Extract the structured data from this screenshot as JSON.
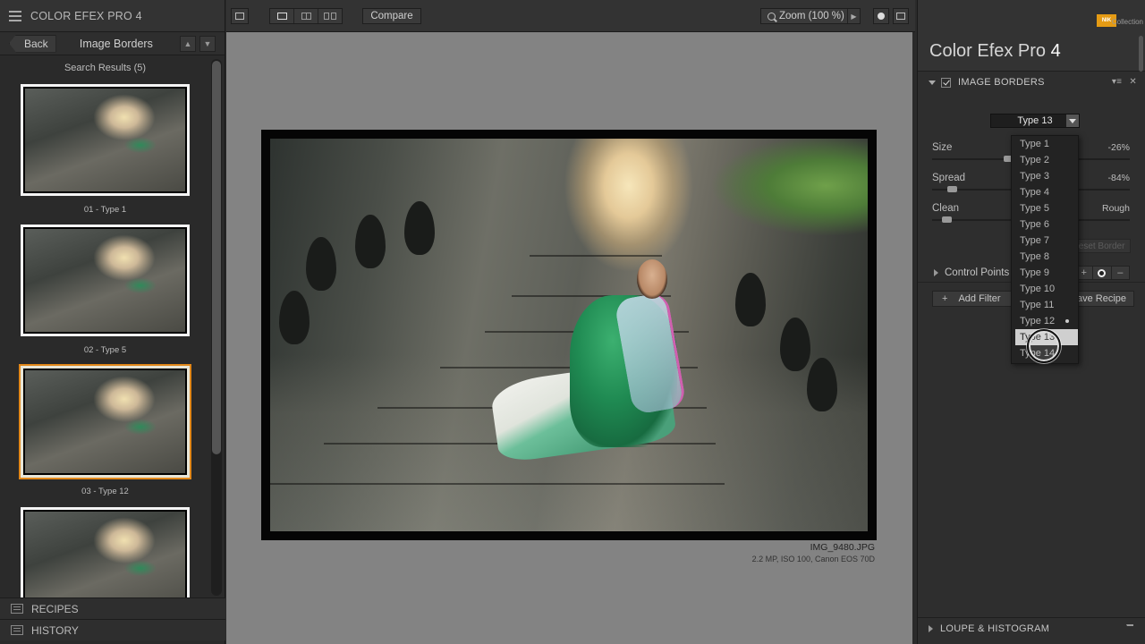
{
  "app": {
    "title": "COLOR EFEX PRO 4"
  },
  "left_panel": {
    "back_label": "Back",
    "nav_title": "Image Borders",
    "results": "Search Results (5)",
    "thumbnails": [
      {
        "label": "01 - Type 1",
        "selected": false
      },
      {
        "label": "02 - Type 5",
        "selected": false
      },
      {
        "label": "03 - Type 12",
        "selected": true
      },
      {
        "label": "",
        "selected": false
      }
    ],
    "recipes_label": "RECIPES",
    "history_label": "HISTORY"
  },
  "toolbar": {
    "compare_label": "Compare",
    "zoom_label": "Zoom (100 %)"
  },
  "image": {
    "file_name": "IMG_9480.JPG",
    "meta": "2.2 MP, ISO 100, Canon EOS 70D"
  },
  "right_panel": {
    "brand_name": "Color Efex Pro",
    "brand_version": "4",
    "logo_text": "NIK",
    "logo_sub": "Collection",
    "filter_title": "IMAGE BORDERS",
    "type_selected": "Type 13",
    "sliders": {
      "size": {
        "label": "Size",
        "value": "-26%",
        "level": 0.38
      },
      "spread": {
        "label": "Spread",
        "value": "-84%",
        "level": 0.08
      },
      "clean": {
        "label": "Clean",
        "value": "Rough",
        "level": 0.05
      }
    },
    "reset_label": "Reset Border",
    "control_points_label": "Control Points",
    "add_filter_label": "Add Filter",
    "save_recipe_label": "Save Recipe",
    "loupe_label": "LOUPE & HISTOGRAM"
  },
  "dropdown": {
    "items": [
      "Type 1",
      "Type 2",
      "Type 3",
      "Type 4",
      "Type 5",
      "Type 6",
      "Type 7",
      "Type 8",
      "Type 9",
      "Type 10",
      "Type 11",
      "Type 12",
      "Type 13",
      "Type 14"
    ],
    "current": "Type 12",
    "highlighted": "Type 13"
  },
  "colors": {
    "selection_accent": "#e2881a",
    "brand_logo": "#e59b14"
  }
}
